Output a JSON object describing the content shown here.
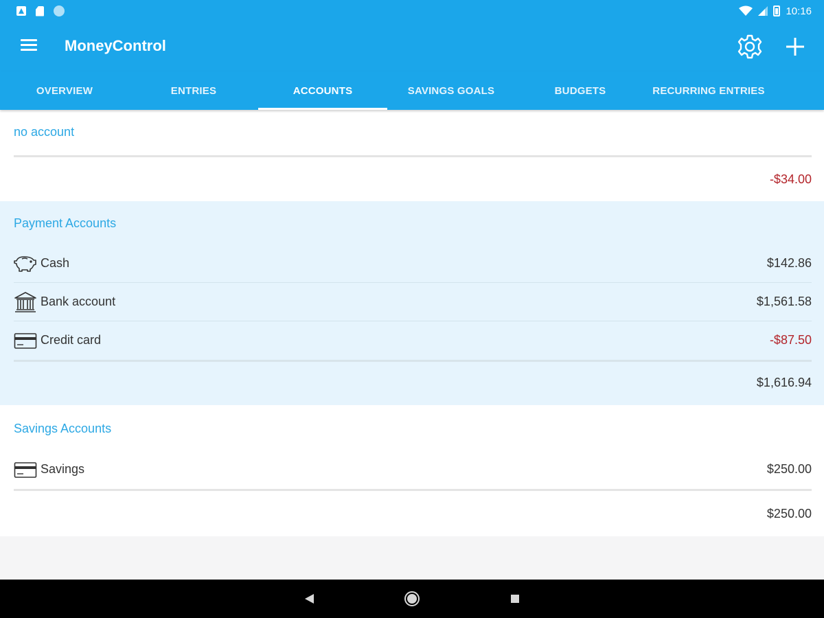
{
  "status_bar": {
    "time": "10:16",
    "icons": [
      "notification-a-icon",
      "sd-card-icon",
      "circle-icon",
      "wifi-icon",
      "signal-icon",
      "battery-icon"
    ]
  },
  "app_bar": {
    "title": "MoneyControl",
    "icons": [
      "menu-icon",
      "settings-icon",
      "add-icon"
    ]
  },
  "tabs": [
    {
      "label": "OVERVIEW",
      "active": false
    },
    {
      "label": "ENTRIES",
      "active": false
    },
    {
      "label": "ACCOUNTS",
      "active": true
    },
    {
      "label": "SAVINGS GOALS",
      "active": false
    },
    {
      "label": "BUDGETS",
      "active": false
    },
    {
      "label": "RECURRING ENTRIES",
      "active": false
    }
  ],
  "no_account": {
    "title": "no account",
    "total": "-$34.00"
  },
  "payment_accounts": {
    "title": "Payment Accounts",
    "items": [
      {
        "label": "Cash",
        "amount": "$142.86",
        "icon": "piggy-bank-icon"
      },
      {
        "label": "Bank account",
        "amount": "$1,561.58",
        "icon": "bank-icon"
      },
      {
        "label": "Credit card",
        "amount": "-$87.50",
        "icon": "credit-card-icon"
      }
    ],
    "total": "$1,616.94"
  },
  "savings_accounts": {
    "title": "Savings Accounts",
    "items": [
      {
        "label": "Savings",
        "amount": "$250.00",
        "icon": "savings-card-icon"
      }
    ],
    "total": "$250.00"
  },
  "colors": {
    "primary": "#1ba6ea",
    "accent_text": "#2ca8e4",
    "negative": "#b3242a",
    "section_blue": "#e6f4fd"
  },
  "nav_bar": {
    "icons": [
      "back-icon",
      "home-icon",
      "recents-icon"
    ]
  }
}
